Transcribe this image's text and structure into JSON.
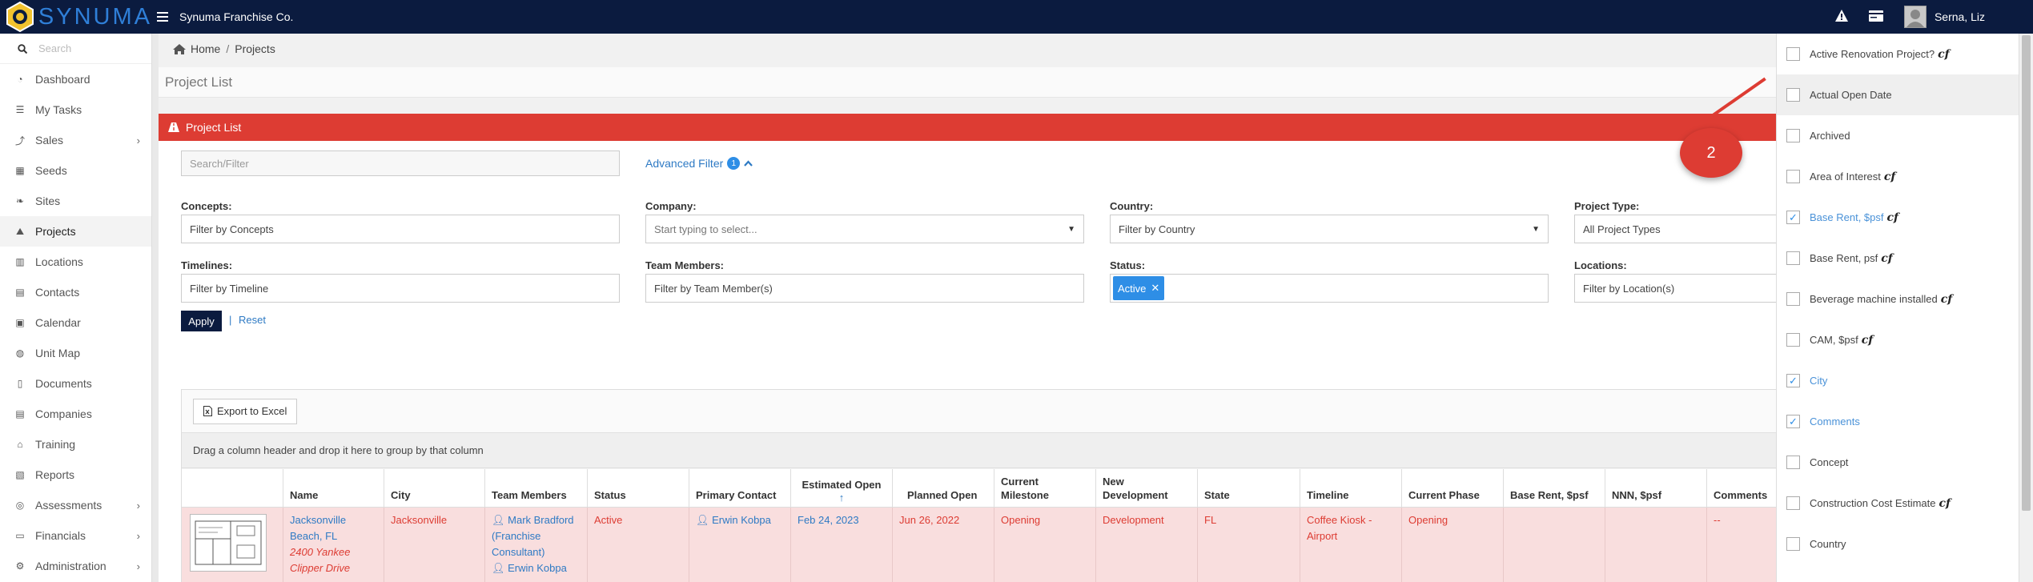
{
  "app": {
    "logo_text": "SYNUMA",
    "company": "Synuma Franchise Co.",
    "user_name": "Serna, Liz"
  },
  "sidebar": {
    "search_placeholder": "Search",
    "items": [
      {
        "label": "Dashboard",
        "icon": "dashboard-icon"
      },
      {
        "label": "My Tasks",
        "icon": "list-icon"
      },
      {
        "label": "Sales",
        "icon": "chart-icon",
        "has_submenu": true
      },
      {
        "label": "Seeds",
        "icon": "grid-icon"
      },
      {
        "label": "Sites",
        "icon": "leaf-icon"
      },
      {
        "label": "Projects",
        "icon": "road-icon",
        "active": true
      },
      {
        "label": "Locations",
        "icon": "building-icon"
      },
      {
        "label": "Contacts",
        "icon": "address-book-icon"
      },
      {
        "label": "Calendar",
        "icon": "calendar-icon"
      },
      {
        "label": "Unit Map",
        "icon": "globe-icon"
      },
      {
        "label": "Documents",
        "icon": "document-icon"
      },
      {
        "label": "Companies",
        "icon": "company-icon"
      },
      {
        "label": "Training",
        "icon": "graduation-cap-icon"
      },
      {
        "label": "Reports",
        "icon": "report-icon"
      },
      {
        "label": "Assessments",
        "icon": "assessment-icon",
        "has_submenu": true
      },
      {
        "label": "Financials",
        "icon": "money-icon",
        "has_submenu": true
      },
      {
        "label": "Administration",
        "icon": "cogs-icon",
        "has_submenu": true
      }
    ]
  },
  "breadcrumb": {
    "home": "Home",
    "current": "Projects"
  },
  "page_title": "Project List",
  "panel_title": "Project List",
  "filters": {
    "search_placeholder": "Search/Filter",
    "advanced_filter_label": "Advanced Filter",
    "advanced_filter_count": "1",
    "concepts_label": "Concepts:",
    "concepts_value": "Filter by Concepts",
    "company_label": "Company:",
    "company_placeholder": "Start typing to select...",
    "country_label": "Country:",
    "country_value": "Filter by Country",
    "project_type_label": "Project Type:",
    "project_type_value": "All Project Types",
    "timelines_label": "Timelines:",
    "timelines_value": "Filter by Timeline",
    "team_members_label": "Team Members:",
    "team_members_value": "Filter by Team Member(s)",
    "status_label": "Status:",
    "status_tag": "Active",
    "locations_label": "Locations:",
    "locations_value": "Filter by Location(s)",
    "apply_label": "Apply",
    "separator": "|",
    "reset_label": "Reset"
  },
  "grid": {
    "export_label": "Export to Excel",
    "group_hint": "Drag a column header and drop it here to group by that column",
    "columns": [
      {
        "key": "name",
        "label": "Name"
      },
      {
        "key": "city",
        "label": "City"
      },
      {
        "key": "team",
        "label": "Team Members"
      },
      {
        "key": "status",
        "label": "Status"
      },
      {
        "key": "contact",
        "label": "Primary Contact"
      },
      {
        "key": "est_open",
        "label": "Estimated Open",
        "sort": "↑"
      },
      {
        "key": "planned_open",
        "label": "Planned Open"
      },
      {
        "key": "milestone",
        "label": "Current Milestone"
      },
      {
        "key": "new_dev",
        "label": "New Development"
      },
      {
        "key": "state",
        "label": "State"
      },
      {
        "key": "timeline",
        "label": "Timeline"
      },
      {
        "key": "phase",
        "label": "Current Phase"
      },
      {
        "key": "base_rent",
        "label": "Base Rent, $psf"
      },
      {
        "key": "nnn",
        "label": "NNN, $psf"
      },
      {
        "key": "comments",
        "label": "Comments"
      }
    ],
    "row": {
      "name_line1": "Jacksonville",
      "name_line2": "Beach, FL",
      "address_line1": "2400 Yankee",
      "address_line2": "Clipper Drive",
      "city": "Jacksonville",
      "team_member1_line1": "Mark Bradford",
      "team_member1_line2": "(Franchise",
      "team_member1_line3": "Consultant)",
      "team_member2": "Erwin Kobpa",
      "status": "Active",
      "contact": "Erwin Kobpa",
      "est_open": "Feb 24, 2023",
      "planned_open": "Jun 26, 2022",
      "milestone": "Opening",
      "new_dev": "Development",
      "state": "FL",
      "timeline_line1": "Coffee Kiosk -",
      "timeline_line2": "Airport",
      "phase": "Opening",
      "comments": "--"
    }
  },
  "column_chooser": {
    "items": [
      {
        "label": "Active Renovation Project?",
        "checked": false,
        "cf": true
      },
      {
        "label": "Actual Open Date",
        "checked": false,
        "cf": false,
        "hover": true
      },
      {
        "label": "Archived",
        "checked": false,
        "cf": false
      },
      {
        "label": "Area of Interest",
        "checked": false,
        "cf": true
      },
      {
        "label": "Base Rent, $psf",
        "checked": true,
        "cf": true
      },
      {
        "label": "Base Rent, psf",
        "checked": false,
        "cf": true
      },
      {
        "label": "Beverage machine installed",
        "checked": false,
        "cf": true
      },
      {
        "label": "CAM, $psf",
        "checked": false,
        "cf": true
      },
      {
        "label": "City",
        "checked": true,
        "cf": false
      },
      {
        "label": "Comments",
        "checked": true,
        "cf": false
      },
      {
        "label": "Concept",
        "checked": false,
        "cf": false
      },
      {
        "label": "Construction Cost Estimate",
        "checked": false,
        "cf": true
      },
      {
        "label": "Country",
        "checked": false,
        "cf": false
      }
    ],
    "cf_mark": "cf"
  },
  "callout": {
    "number": "2"
  },
  "colors": {
    "topbar": "#0b1b3f",
    "accent_red": "#dd3c33",
    "link_blue": "#2e7ac4",
    "row_bg": "#f9dede"
  }
}
